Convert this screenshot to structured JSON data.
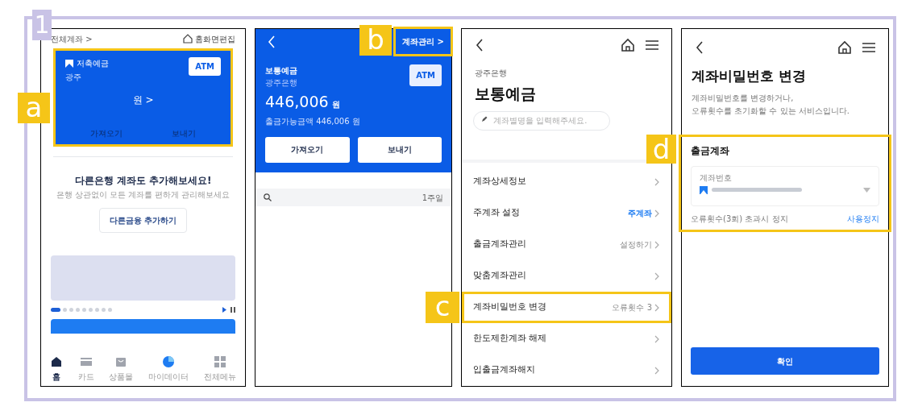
{
  "step": "1",
  "panel_1": {
    "header_link": "전체계좌 >",
    "edit_link": "홈화면편집",
    "account_card": {
      "highlighted": true,
      "callout": "a",
      "product": "저축예금",
      "bank": "광주",
      "atm": "ATM",
      "balance": "원 >",
      "actions": [
        "가져오기",
        "보내기"
      ]
    },
    "promo": {
      "title": "다른은행 계좌도 추가해보세요!",
      "subtitle": "은행 상관없이 모든 계좌를 편하게 관리해보세요",
      "button": "다른금융 추가하기"
    },
    "carousel_dots": [
      {
        "selected": true
      },
      {
        "selected": false
      },
      {
        "selected": false
      },
      {
        "selected": false
      },
      {
        "selected": false
      },
      {
        "selected": false
      },
      {
        "selected": false
      },
      {
        "selected": false
      },
      {
        "selected": false
      }
    ],
    "nav": [
      {
        "label": "홈",
        "kind": "home",
        "selected": true
      },
      {
        "label": "카드",
        "kind": "card",
        "selected": false
      },
      {
        "label": "상품몰",
        "kind": "bag",
        "selected": false
      },
      {
        "label": "마이데이터",
        "kind": "pie",
        "selected": false
      },
      {
        "label": "전체메뉴",
        "kind": "grid",
        "selected": false
      }
    ]
  },
  "panel_2": {
    "manage_link": {
      "label": "계좌관리 >",
      "highlighted": true,
      "callout": "b"
    },
    "account": {
      "product": "보통예금",
      "bank": "광주은행",
      "atm": "ATM",
      "amount": "446,006",
      "unit": "원",
      "available": "출금가능금액 446,006 원"
    },
    "actions": [
      "가져오기",
      "보내기"
    ],
    "period": "1주일"
  },
  "panel_3": {
    "bank": "광주은행",
    "title": "보통예금",
    "nickname_placeholder": "계좌별명을 입력해주세요.",
    "menu": [
      {
        "label": "계좌상세정보",
        "highlighted": false
      },
      {
        "label": "주계좌 설정",
        "value": "주계좌",
        "kind": "link",
        "highlighted": false
      },
      {
        "label": "출금계좌관리",
        "value": "설정하기",
        "kind": "plain",
        "highlighted": false
      },
      {
        "label": "맞춤계좌관리",
        "highlighted": false
      },
      {
        "label": "계좌비밀번호 변경",
        "value": "오류횟수 3",
        "kind": "plain",
        "highlighted": true,
        "callout": "c"
      },
      {
        "label": "한도제한계좌 해제",
        "highlighted": false
      },
      {
        "label": "입출금계좌해지",
        "highlighted": false
      }
    ]
  },
  "panel_4": {
    "title": "계좌비밀번호 변경",
    "description": [
      "계좌비밀번호를 변경하거나,",
      "오류횟수를 초기화할 수 있는 서비스입니다."
    ],
    "section": {
      "highlighted": true,
      "callout": "d",
      "title": "출금계좌",
      "field_label": "계좌번호",
      "note": "오류횟수(3회) 초과시 정지",
      "action": "사용정지"
    },
    "confirm_button": "확인"
  }
}
